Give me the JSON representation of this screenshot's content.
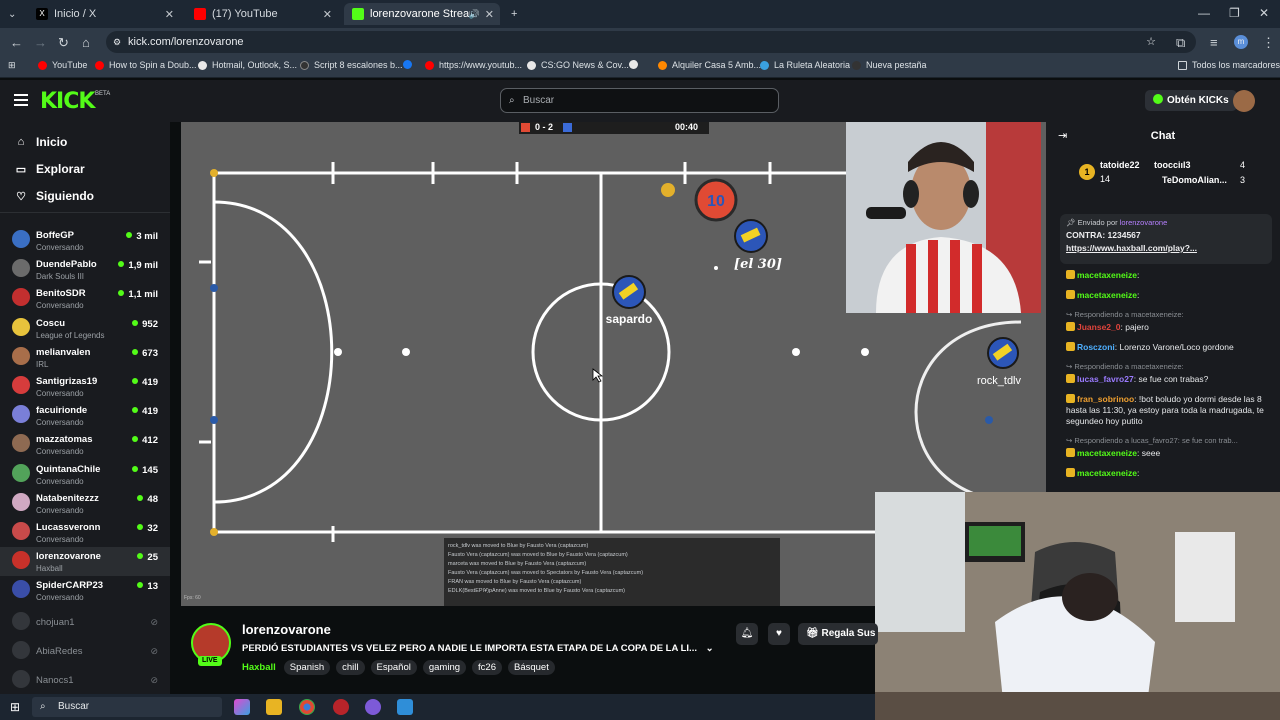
{
  "browser": {
    "tabs": [
      {
        "label": "Inicio / X",
        "color": "#000000"
      },
      {
        "label": "(17) YouTube",
        "color": "#ff0000"
      },
      {
        "label": "lorenzovarone Stream - Wa",
        "color": "#53fc18"
      }
    ],
    "new_tab": "+",
    "url": "kick.com/lorenzovarone",
    "bookmarks": [
      {
        "label": "YouTube",
        "color": "#ff0000"
      },
      {
        "label": "How to Spin a Doub...",
        "color": "#ff0000"
      },
      {
        "label": "Hotmail, Outlook, S...",
        "color": "#e8e8e8"
      },
      {
        "label": "Script 8 escalones b...",
        "color": "#333333"
      },
      {
        "label": "https://www.youtub...",
        "color": "#ff0000"
      },
      {
        "label": "CS:GO News & Cov...",
        "color": "#e8e8e8"
      },
      {
        "label": "Alquiler Casa 5 Amb...",
        "color": "#ff8800"
      },
      {
        "label": "La Ruleta Aleatoria",
        "color": "#3aa0e0"
      },
      {
        "label": "Nueva pestaña",
        "color": "#333333"
      }
    ],
    "all_bookmarks": "Todos los marcadores"
  },
  "header": {
    "logo": "KICK",
    "beta": "BETA",
    "search_placeholder": "Buscar",
    "get_kicks": "Obtén KICKs"
  },
  "sidebar": {
    "nav": [
      {
        "label": "Inicio",
        "icon": "⌂"
      },
      {
        "label": "Explorar",
        "icon": "▭"
      },
      {
        "label": "Siguiendo",
        "icon": "♡"
      }
    ],
    "channels": [
      {
        "name": "BoffeGP",
        "game": "Conversando",
        "viewers": "3 mil",
        "color": "#3a6fc4"
      },
      {
        "name": "DuendePablo",
        "game": "Dark Souls III",
        "viewers": "1,9 mil",
        "color": "#6b6b6b"
      },
      {
        "name": "BenitoSDR",
        "game": "Conversando",
        "viewers": "1,1 mil",
        "color": "#c32f2f"
      },
      {
        "name": "Coscu",
        "game": "League of Legends",
        "viewers": "952",
        "color": "#e7c33c"
      },
      {
        "name": "melianvalen",
        "game": "IRL",
        "viewers": "673",
        "color": "#a86e4a"
      },
      {
        "name": "Santigrizas19",
        "game": "Conversando",
        "viewers": "419",
        "color": "#d63c3c"
      },
      {
        "name": "facuirionde",
        "game": "Conversando",
        "viewers": "419",
        "color": "#7a7fd8"
      },
      {
        "name": "mazzatomas",
        "game": "Conversando",
        "viewers": "412",
        "color": "#8e6a52"
      },
      {
        "name": "QuintanaChile",
        "game": "Conversando",
        "viewers": "145",
        "color": "#52a35a"
      },
      {
        "name": "Natabenitezzz",
        "game": "Conversando",
        "viewers": "48",
        "color": "#d0a9c2"
      },
      {
        "name": "Lucassveronn",
        "game": "Conversando",
        "viewers": "32",
        "color": "#c84a4a"
      },
      {
        "name": "lorenzovarone",
        "game": "Haxball",
        "viewers": "25",
        "color": "#c8312a"
      },
      {
        "name": "SpiderCARP23",
        "game": "Conversando",
        "viewers": "13",
        "color": "#3a4ea8"
      }
    ],
    "offline": [
      {
        "name": "chojuan1"
      },
      {
        "name": "AbiaRedes"
      },
      {
        "name": "Nanocs1"
      }
    ]
  },
  "game": {
    "score": "0 - 2",
    "time": "00:40",
    "players": [
      {
        "label": "10",
        "team": "red"
      },
      {
        "label": "[el 30]",
        "team": "blue"
      },
      {
        "label": "sapardo",
        "team": "blue"
      },
      {
        "label": "rock_tdlv",
        "team": "blue"
      }
    ],
    "log": [
      "rock_tdlv was moved to Blue by Fausto Vera (captazcum)",
      "Fausto Vera (captazcum) was moved to Blue by Fausto Vera (captazcum)",
      "marceta was moved to Blue by Fausto Vera (captazcum)",
      "Fausto Vera (captazcum) was moved to Spectators by Fausto Vera (captazcum)",
      "FRAN was moved to Blue by Fausto Vera (captazcum)",
      "EDLK(BestEPí¥)pAnne) was moved to Blue by Fausto Vera (captazcum)"
    ],
    "fps": "Fps: 60"
  },
  "stream": {
    "name": "lorenzovarone",
    "live": "LIVE",
    "title": "PERDIÓ ESTUDIANTES VS VELEZ PERO A NADIE LE IMPORTA ESTA ETAPA DE LA COPA DE LA LI...",
    "category": "Haxball",
    "tags": [
      "Spanish",
      "chill",
      "Español",
      "gaming",
      "fc26",
      "Básquet"
    ],
    "gift": "Regala Sus"
  },
  "chat": {
    "title": "Chat",
    "leaderboard": [
      {
        "name": "tatoide22",
        "count": "14",
        "rank": "1"
      },
      {
        "name": "toocciıl3",
        "count": "4"
      },
      {
        "name": "TeDomoAlian...",
        "count": "3"
      }
    ],
    "pinned": {
      "by_prefix": "Enviado por",
      "by_user": "lorenzovarone",
      "text": "CONTRA: 1234567",
      "link": "https://www.haxball.com/play?..."
    },
    "messages": [
      {
        "type": "msg",
        "user": "macetaxeneize",
        "text": "",
        "color": "#53fc18"
      },
      {
        "type": "msg",
        "user": "macetaxeneize",
        "text": "",
        "color": "#53fc18"
      },
      {
        "type": "reply",
        "text": "Respondiendo a macetaxeneize:"
      },
      {
        "type": "msg",
        "user": "Juanse2_0",
        "text": "pajero",
        "color": "#e0443c"
      },
      {
        "type": "msg",
        "user": "Rosczoni",
        "text": "Lorenzo Varone/Loco gordone",
        "color": "#4fb0ff"
      },
      {
        "type": "reply",
        "text": "Respondiendo a macetaxeneize:"
      },
      {
        "type": "msg",
        "user": "lucas_favro27",
        "text": "se fue con trabas?",
        "color": "#9b7bff"
      },
      {
        "type": "msg",
        "user": "fran_sobrinoo",
        "text": "!bot boludo yo dormi desde las 8 hasta las 11:30, ya estoy para toda la madrugada, te segundeo hoy putito",
        "color": "#f0a030"
      },
      {
        "type": "reply",
        "text": "Respondiendo a lucas_favro27: se fue con trab..."
      },
      {
        "type": "msg",
        "user": "macetaxeneize",
        "text": "seee",
        "color": "#53fc18"
      },
      {
        "type": "msg",
        "user": "macetaxeneize",
        "text": "",
        "color": "#53fc18"
      }
    ]
  },
  "taskbar": {
    "search": "Buscar"
  }
}
